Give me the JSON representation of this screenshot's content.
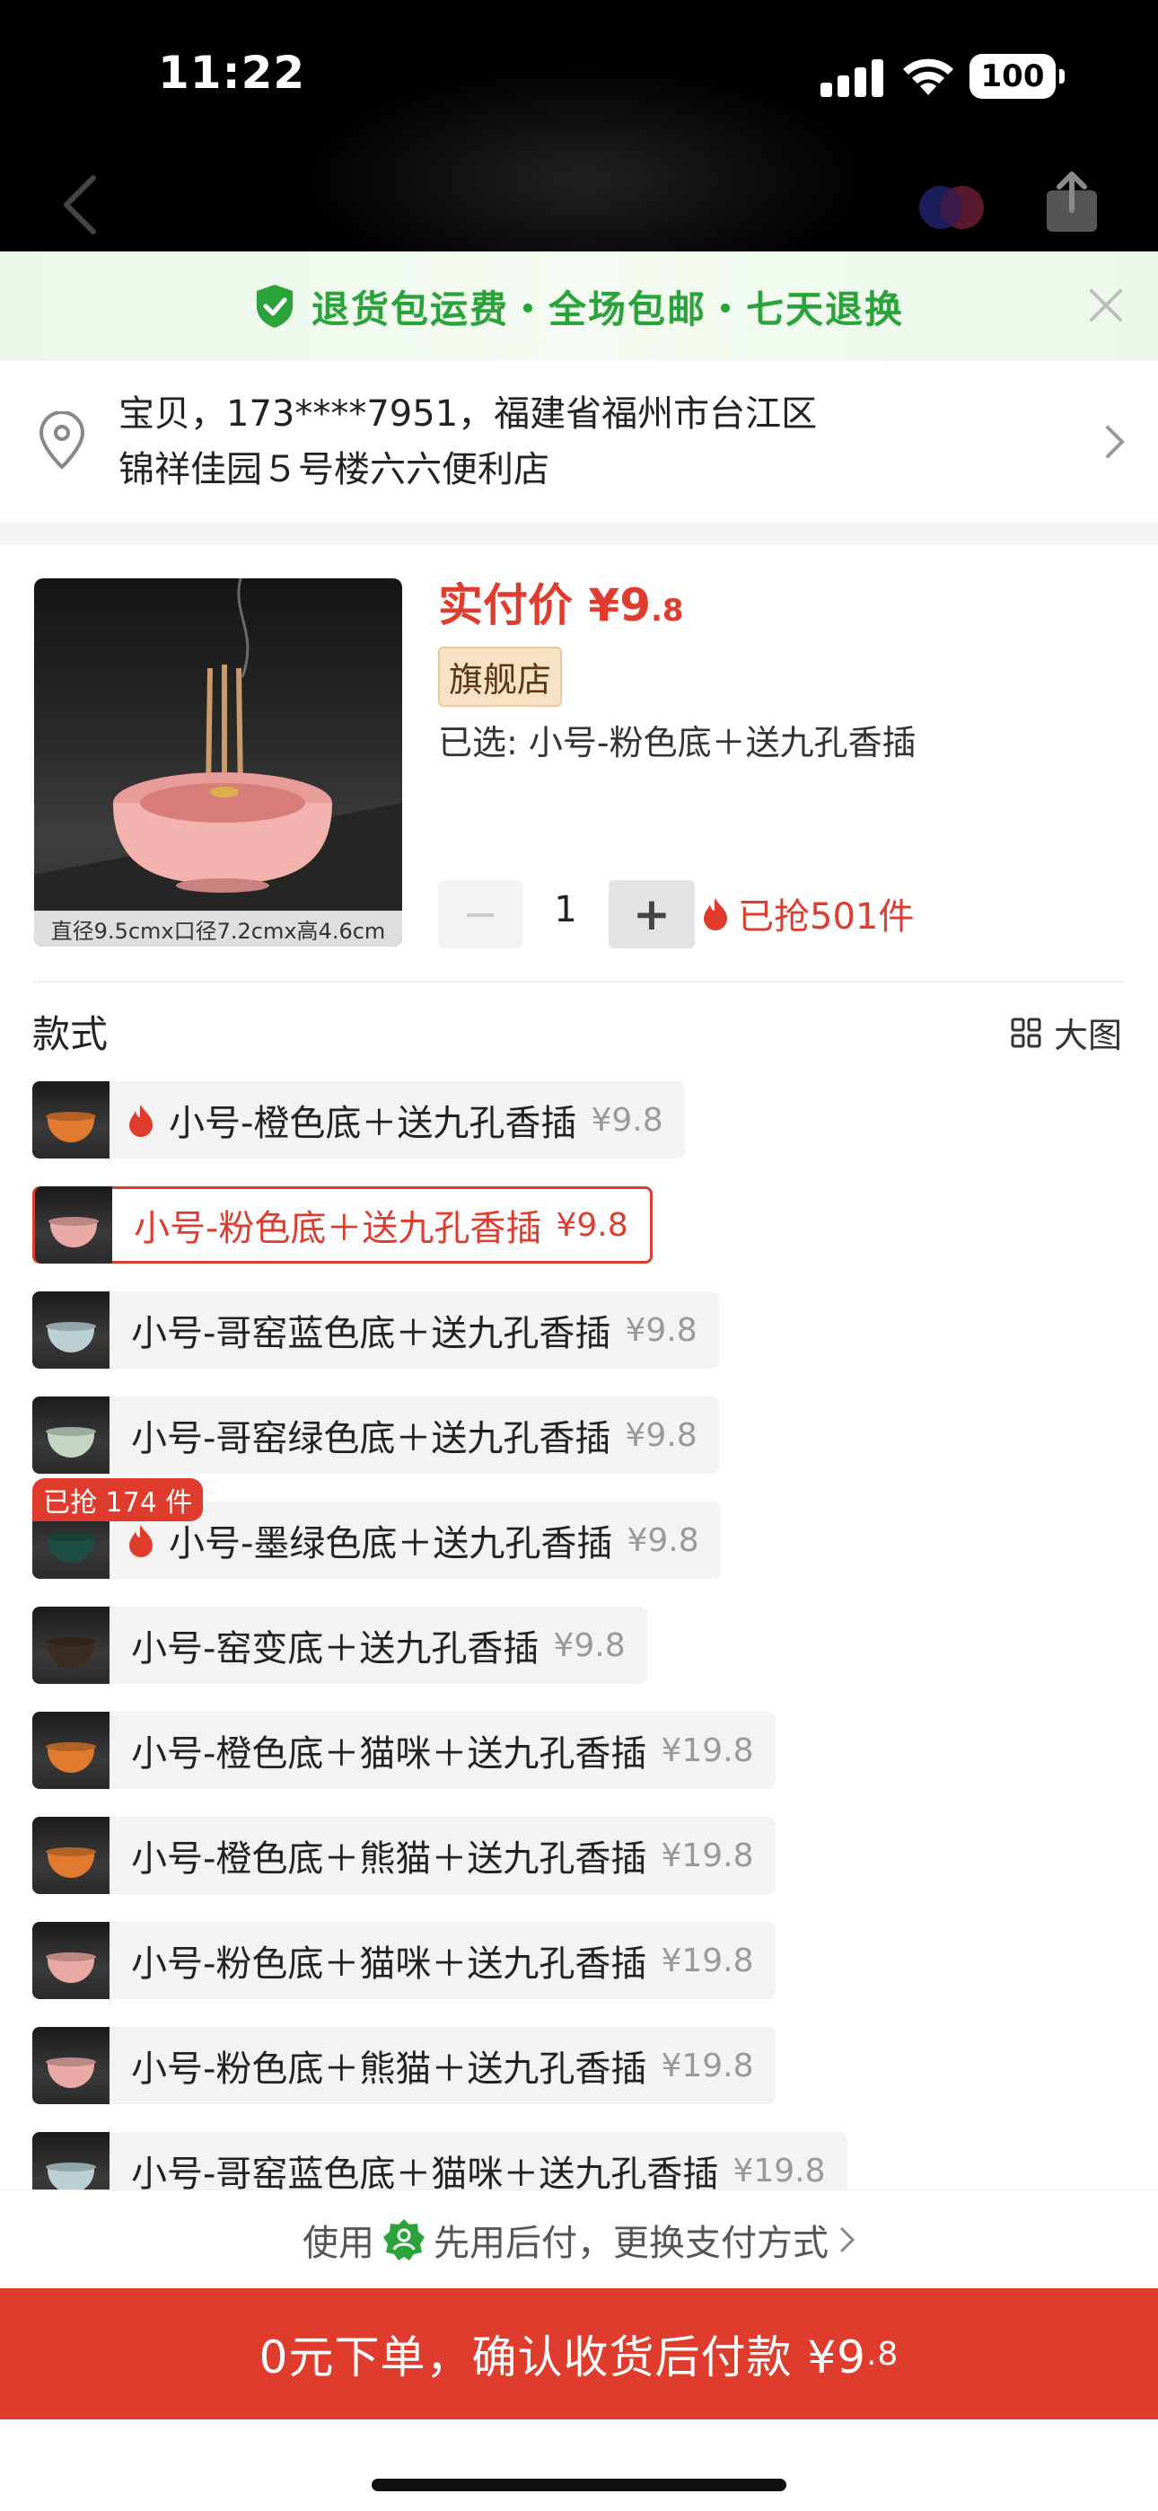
{
  "status_bar": {
    "time": "11:22",
    "battery": "100"
  },
  "promo": {
    "text": "退货包运费・全场包邮・七天退换"
  },
  "address": {
    "line1": "宝贝，173****7951，福建省福州市台江区",
    "line2": "锦祥佳园５号楼六六便利店"
  },
  "product": {
    "image_caption": "直径9.5cmx口径7.2cmx高4.6cm",
    "price_label": "实付价 ¥9",
    "price_decimal": ".8",
    "store_tag": "旗舰店",
    "selected": "已选: 小号-粉色底＋送九孔香插",
    "quantity": "1",
    "sold": "已抢501件",
    "minus": "−",
    "plus": "+"
  },
  "section": {
    "title": "款式",
    "bigview": "大图"
  },
  "variants": [
    {
      "name": "小号-橙色底＋送九孔香插",
      "price": "¥9.8",
      "hot": true,
      "color": "#e07a2e"
    },
    {
      "name": "小号-粉色底＋送九孔香插",
      "price": "¥9.8",
      "selected": true,
      "color": "#e9a9a4"
    },
    {
      "name": "小号-哥窑蓝色底＋送九孔香插",
      "price": "¥9.8",
      "color": "#b9cfd3"
    },
    {
      "name": "小号-哥窑绿色底＋送九孔香插",
      "price": "¥9.8",
      "color": "#c3d6c3"
    },
    {
      "name": "小号-墨绿色底＋送九孔香插",
      "price": "¥9.8",
      "hot": true,
      "badge": "已抢 174 件",
      "color": "#1e4d44"
    },
    {
      "name": "小号-窑变底＋送九孔香插",
      "price": "¥9.8",
      "color": "#3b2d22"
    },
    {
      "name": "小号-橙色底＋猫咪＋送九孔香插",
      "price": "¥19.8",
      "color": "#e07a2e"
    },
    {
      "name": "小号-橙色底＋熊猫＋送九孔香插",
      "price": "¥19.8",
      "color": "#e07a2e"
    },
    {
      "name": "小号-粉色底＋猫咪＋送九孔香插",
      "price": "¥19.8",
      "color": "#e9a9a4"
    },
    {
      "name": "小号-粉色底＋熊猫＋送九孔香插",
      "price": "¥19.8",
      "color": "#e9a9a4"
    },
    {
      "name": "小号-哥窑蓝色底＋猫咪＋送九孔香插",
      "price": "¥19.8",
      "color": "#b9cfd3"
    }
  ],
  "pay_bar": {
    "prefix": "使用",
    "text": "先用后付，更换支付方式"
  },
  "cta": {
    "label": "0元下单，确认收货后付款 ¥9",
    "decimal": ".8"
  },
  "colors": {
    "accent": "#e03c2d",
    "promo_green": "#2aa33a",
    "store_tag_bg": "#f7e2c6"
  }
}
